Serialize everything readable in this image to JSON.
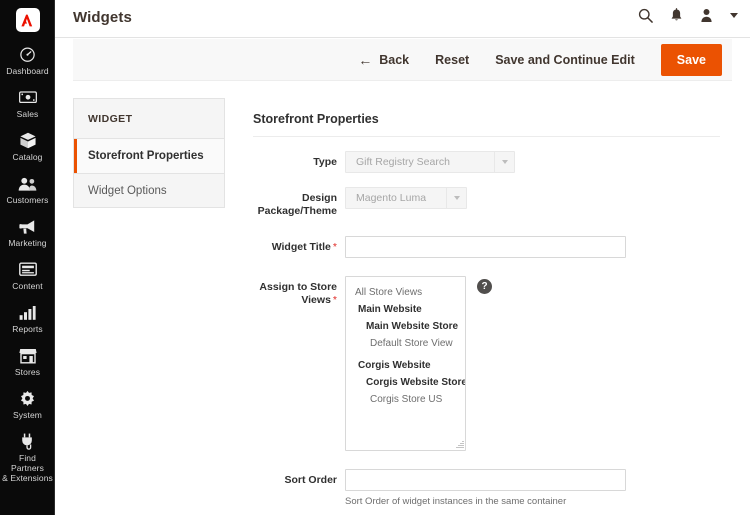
{
  "sidebar": {
    "logo_name": "adobe-logo",
    "items": [
      {
        "label": "Dashboard",
        "icon": "dashboard-icon"
      },
      {
        "label": "Sales",
        "icon": "sales-icon"
      },
      {
        "label": "Catalog",
        "icon": "catalog-icon"
      },
      {
        "label": "Customers",
        "icon": "customers-icon"
      },
      {
        "label": "Marketing",
        "icon": "marketing-icon"
      },
      {
        "label": "Content",
        "icon": "content-icon"
      },
      {
        "label": "Reports",
        "icon": "reports-icon"
      },
      {
        "label": "Stores",
        "icon": "stores-icon"
      },
      {
        "label": "System",
        "icon": "system-icon"
      },
      {
        "label": "Find Partners\n& Extensions",
        "icon": "plug-icon"
      }
    ]
  },
  "header": {
    "title": "Widgets",
    "icons": [
      {
        "name": "search-icon"
      },
      {
        "name": "notifications-bell-icon"
      },
      {
        "name": "account-user-icon"
      },
      {
        "name": "chevron-down-icon"
      }
    ]
  },
  "toolbar": {
    "back_label": "Back",
    "back_arrow": "←",
    "reset_label": "Reset",
    "save_continue_label": "Save and Continue Edit",
    "save_label": "Save"
  },
  "tabs": {
    "heading": "WIDGET",
    "items": [
      {
        "label": "Storefront Properties",
        "active": true
      },
      {
        "label": "Widget Options",
        "active": false
      }
    ]
  },
  "form": {
    "section_title": "Storefront Properties",
    "type": {
      "label": "Type",
      "value": "Gift Registry Search"
    },
    "theme": {
      "label": "Design Package/Theme",
      "value": "Magento Luma"
    },
    "widget_title": {
      "label": "Widget Title",
      "required_marker": "*",
      "value": "",
      "placeholder": ""
    },
    "assign_store_views": {
      "label": "Assign to Store Views",
      "required_marker": "*",
      "help_glyph": "?",
      "options": [
        {
          "text": "All Store Views",
          "level": "all"
        },
        {
          "text": "Main Website",
          "level": "website"
        },
        {
          "text": "Main Website Store",
          "level": "group"
        },
        {
          "text": "Default Store View",
          "level": "view"
        },
        {
          "text": "",
          "level": "spacer"
        },
        {
          "text": "Corgis Website",
          "level": "website"
        },
        {
          "text": "Corgis Website Store",
          "level": "group"
        },
        {
          "text": "Corgis Store US",
          "level": "view"
        }
      ]
    },
    "sort_order": {
      "label": "Sort Order",
      "value": "",
      "placeholder": "",
      "note": "Sort Order of widget instances in the same container"
    }
  },
  "colors": {
    "accent_orange": "#eb5202",
    "sidebar_black": "#0a0a0a",
    "required_red": "#e02b27",
    "adobe_red": "#eb1000",
    "text_dark": "#303030",
    "toolbar_bg": "#f8f8f8",
    "tab_bg": "#f5f5f5"
  }
}
